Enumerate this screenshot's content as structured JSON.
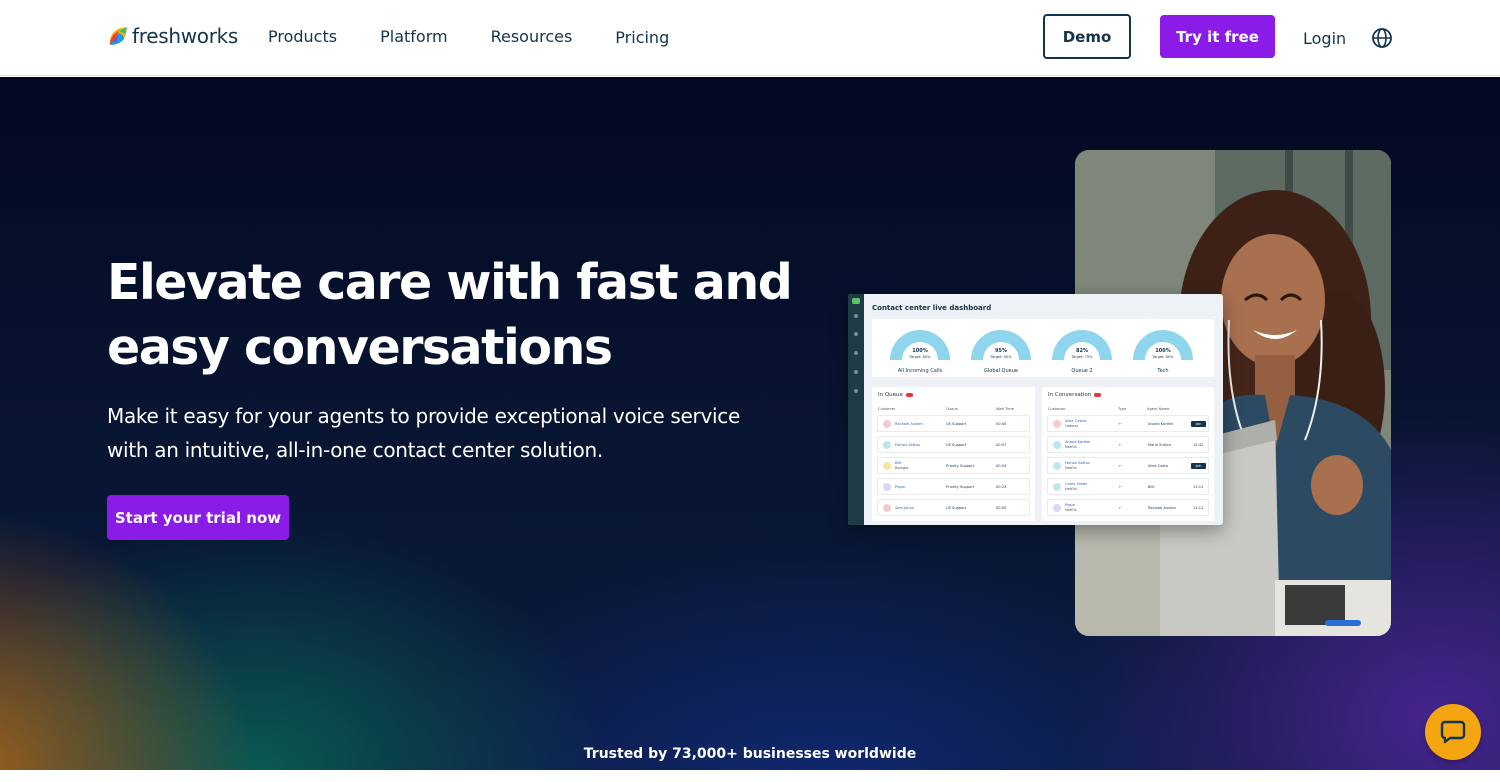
{
  "header": {
    "logo_text": "freshworks",
    "nav": [
      "Products",
      "Platform",
      "Resources",
      "Pricing"
    ],
    "demo_label": "Demo",
    "try_label": "Try it free",
    "login_label": "Login"
  },
  "hero": {
    "headline_line1": "Elevate care with fast and",
    "headline_line2": "easy conversations",
    "subtext_line1": "Make it easy for your agents to provide exceptional voice service",
    "subtext_line2": "with an intuitive, all-in-one contact center solution.",
    "cta_label": "Start your trial now",
    "trusted": "Trusted by 73,000+ businesses worldwide"
  },
  "dashboard": {
    "title": "Contact center live dashboard",
    "gauges": [
      {
        "value": "100%",
        "target": "Target: 80%",
        "label": "All Incoming Calls",
        "fill": 1.0
      },
      {
        "value": "95%",
        "target": "Target: 90%",
        "label": "Global Queue",
        "fill": 0.95
      },
      {
        "value": "82%",
        "target": "Target: 75%",
        "label": "Queue 2",
        "fill": 0.82
      },
      {
        "value": "100%",
        "target": "Target: 80%",
        "label": "Tech",
        "fill": 1.0
      }
    ],
    "queue": {
      "title": "In Queue",
      "headers": [
        "Customer",
        "Queue",
        "Wait Time"
      ],
      "rows": [
        {
          "name": "Rachael Austen",
          "sub": "",
          "queue": "US Support",
          "time": "00:45",
          "avatar": "#f6c9cf"
        },
        {
          "name": "Farhan Akthar",
          "sub": "",
          "queue": "US Support",
          "time": "00:07",
          "avatar": "#bfe6ea"
        },
        {
          "name": "Billi",
          "sub": "Baingar",
          "queue": "Priority Support",
          "time": "00:54",
          "avatar": "#f8e7a4"
        },
        {
          "name": "Pippa",
          "sub": "",
          "queue": "Priority Support",
          "time": "00:23",
          "avatar": "#dcd6f7"
        },
        {
          "name": "Sam Johns",
          "sub": "",
          "queue": "US Support",
          "time": "00:05",
          "avatar": "#f6c9cf"
        }
      ]
    },
    "conversation": {
      "title": "In Conversation",
      "headers": [
        "Customer",
        "Type",
        "Agent Name"
      ],
      "join_label": "Join",
      "rows": [
        {
          "name": "Alice Castro",
          "sub": "Hotstar",
          "type": "←",
          "agent": "Anand Karthik",
          "right": "Join",
          "avatar": "#f6c9cf"
        },
        {
          "name": "Anand Karthik",
          "sub": "Netflix",
          "type": "←",
          "agent": "Maria Sutton",
          "right": "15:32",
          "avatar": "#bfe6ea"
        },
        {
          "name": "Farhan Akthar",
          "sub": "Netflix",
          "type": "←",
          "agent": "Alice Costa",
          "right": "Join",
          "avatar": "#bfe6ea"
        },
        {
          "name": "Corey Foster",
          "sub": "Netflix",
          "type": "←",
          "agent": "Billi",
          "right": "13:12",
          "avatar": "#bfe6ea"
        },
        {
          "name": "Pippa",
          "sub": "Netflix",
          "type": "←",
          "agent": "Rachael Austen",
          "right": "13:12",
          "avatar": "#dcd6f7"
        }
      ]
    }
  },
  "colors": {
    "accent": "#8b1ce8",
    "navy": "#12344d",
    "chat": "#f5a50f"
  },
  "icons": [
    "freshworks-logo-icon",
    "globe-icon",
    "chat-icon"
  ]
}
